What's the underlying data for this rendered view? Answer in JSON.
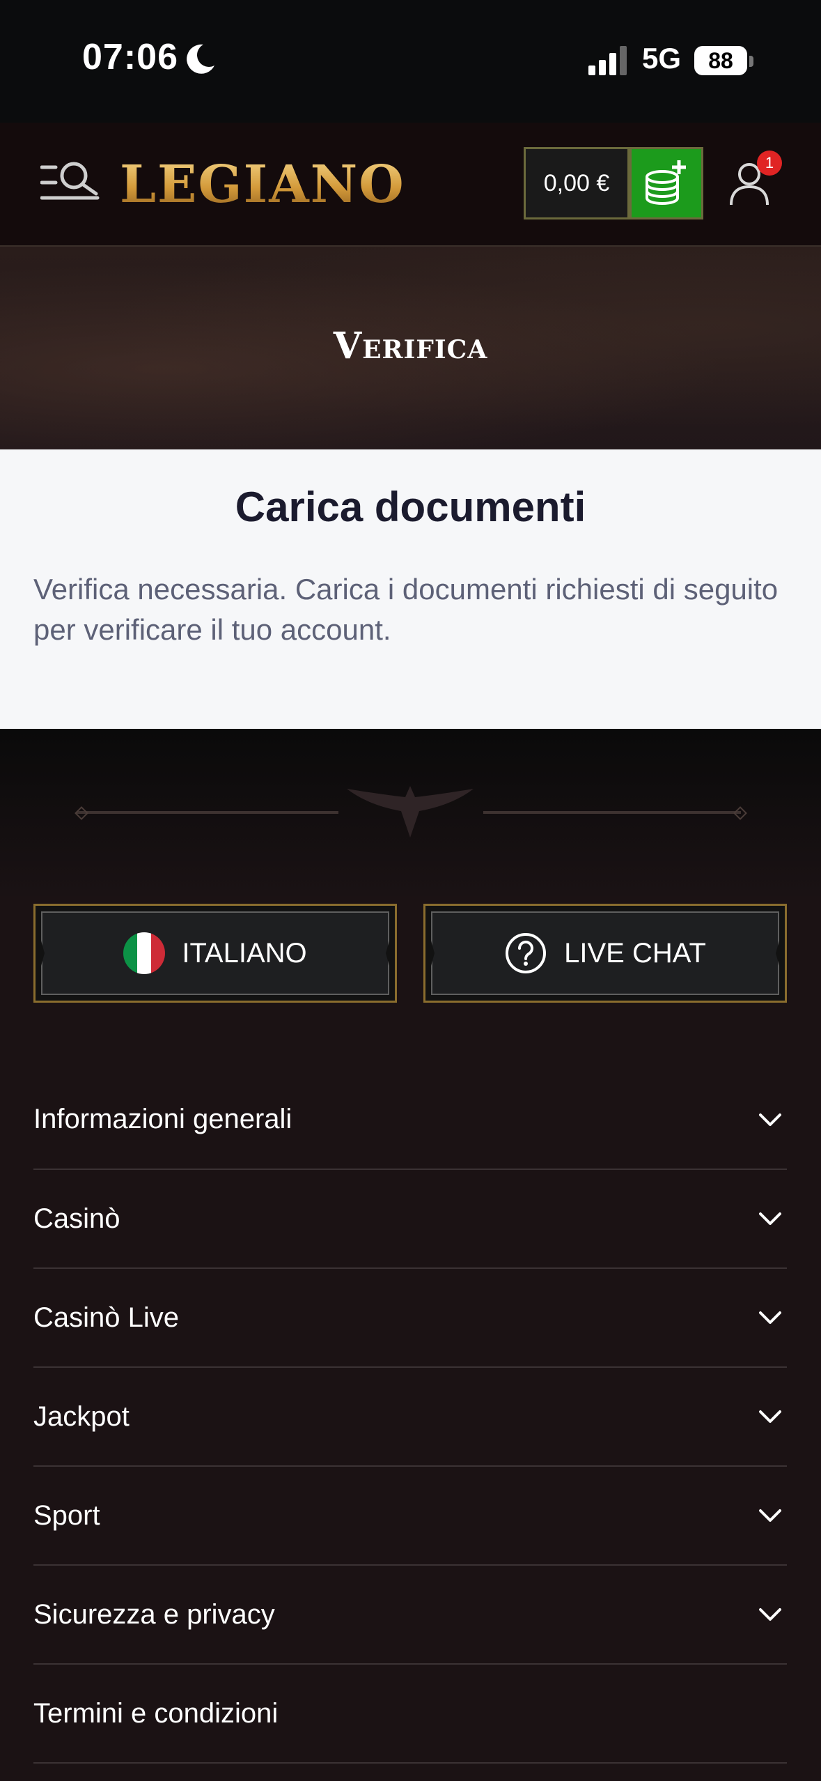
{
  "status_bar": {
    "time": "07:06",
    "network": "5G",
    "battery": "88"
  },
  "header": {
    "logo": "LEGIANO",
    "balance": "0,00 €",
    "notification_count": "1"
  },
  "hero": {
    "title": "Verifica"
  },
  "content": {
    "heading": "Carica documenti",
    "message": "Verifica necessaria. Carica i documenti richiesti di seguito per verificare il tuo account."
  },
  "footer": {
    "language_button": "ITALIANO",
    "chat_button": "LIVE CHAT",
    "sections": [
      {
        "label": "Informazioni generali",
        "has_chevron": true
      },
      {
        "label": "Casinò",
        "has_chevron": true
      },
      {
        "label": "Casinò Live",
        "has_chevron": true
      },
      {
        "label": "Jackpot",
        "has_chevron": true
      },
      {
        "label": "Sport",
        "has_chevron": true
      },
      {
        "label": "Sicurezza e privacy",
        "has_chevron": true
      },
      {
        "label": "Termini e condizioni",
        "has_chevron": false
      }
    ]
  },
  "colors": {
    "accent_gold": "#d39a3a",
    "deposit_green": "#1c9b1c",
    "badge_red": "#e02424",
    "footer_bg": "#1b1214"
  }
}
